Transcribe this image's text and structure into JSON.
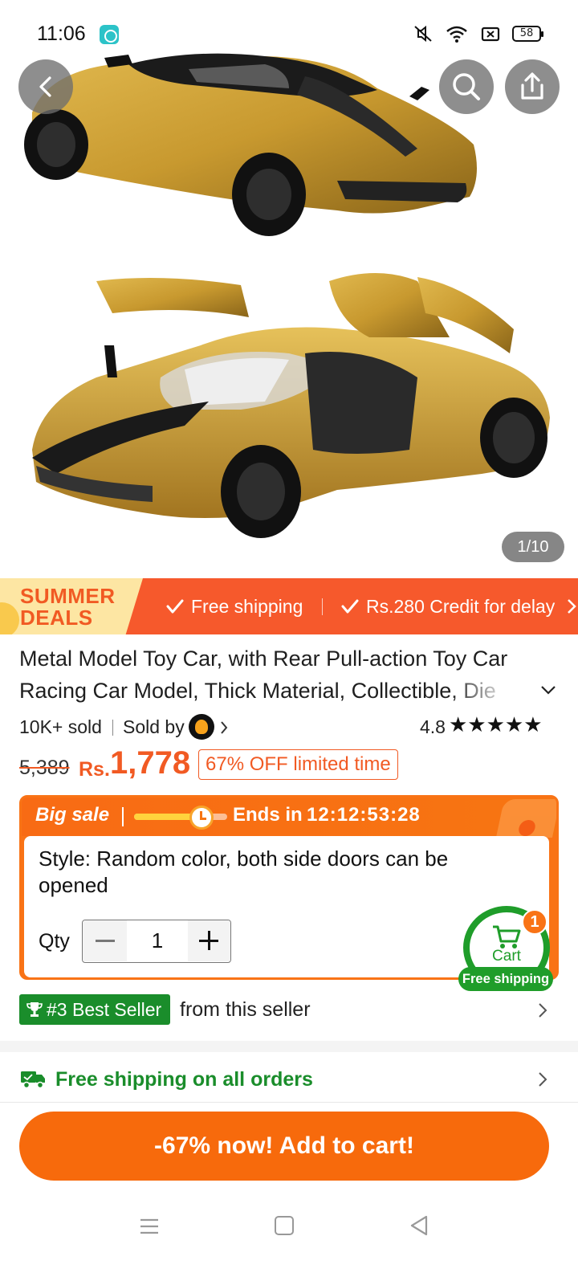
{
  "status_bar": {
    "time": "11:06",
    "battery": "58",
    "icons": [
      "app-notification-icon",
      "mute-icon",
      "wifi-icon",
      "screen-record-icon",
      "battery-icon"
    ]
  },
  "hero": {
    "counter": "1/10",
    "buttons": [
      "back-icon",
      "search-icon",
      "share-icon"
    ]
  },
  "deals": {
    "badge_line1": "SUMMER",
    "badge_line2": "DEALS",
    "item1": "Free shipping",
    "item2": "Rs.280 Credit for delay"
  },
  "product": {
    "title": "Metal Model Toy Car, with Rear Pull-action Toy Car Racing Car Model, Thick Material, Collectible, Die",
    "sold": "10K+ sold",
    "sold_by": "Sold by",
    "rating": "4.8",
    "stars": "★★★★★",
    "old_price": "5,389",
    "currency": "Rs.",
    "price": "1,778",
    "discount": "67% OFF limited time"
  },
  "sale": {
    "title": "Big sale",
    "ends_label": "Ends in",
    "ends_time": "12:12:53:28",
    "progress": 0.75,
    "style_text": "Style: Random color, both side doors can be opened",
    "qty_label": "Qty",
    "qty_value": "1"
  },
  "cart": {
    "label": "Cart",
    "count": "1",
    "shipping": "Free shipping"
  },
  "best_seller": {
    "badge": "#3 Best Seller",
    "text": "from this seller"
  },
  "shipping": {
    "label": "Free shipping on all orders"
  },
  "cta": {
    "label": "-67% now! Add to cart!"
  },
  "colors": {
    "accent": "#f15a23",
    "deals_bar": "#f6592c",
    "green": "#1a8d2b",
    "cta": "#f76a0c",
    "car_gold": "#c8992f"
  }
}
